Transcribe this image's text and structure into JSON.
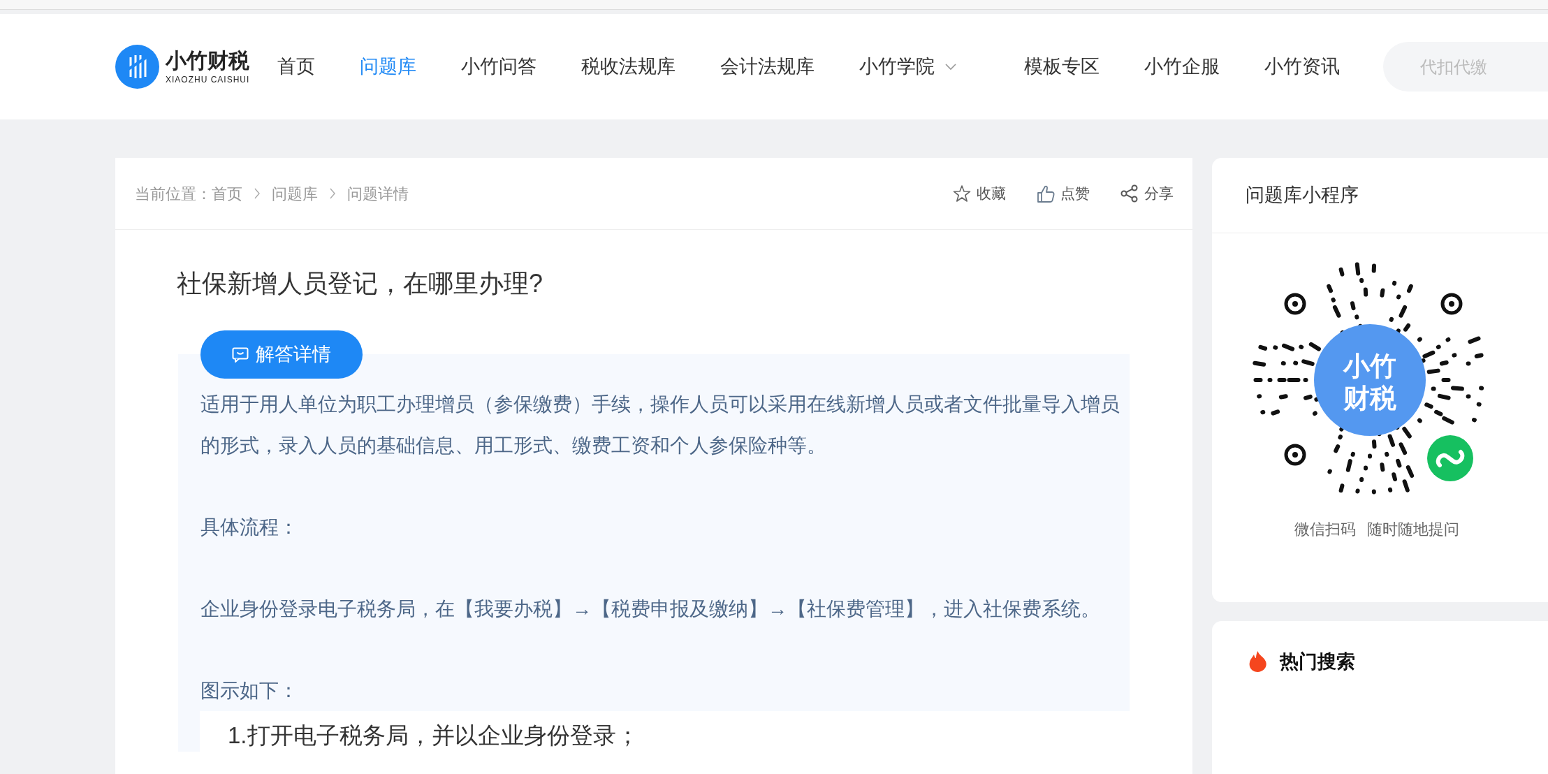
{
  "header": {
    "logo": {
      "name": "小竹财税",
      "subtitle": "XIAOZHU CAISHUI"
    },
    "nav": [
      {
        "label": "首页",
        "selected": false,
        "dropdown": false
      },
      {
        "label": "问题库",
        "selected": true,
        "dropdown": false
      },
      {
        "label": "小竹问答",
        "selected": false,
        "dropdown": false
      },
      {
        "label": "税收法规库",
        "selected": false,
        "dropdown": false
      },
      {
        "label": "会计法规库",
        "selected": false,
        "dropdown": false
      },
      {
        "label": "小竹学院",
        "selected": false,
        "dropdown": true
      },
      {
        "label": "模板专区",
        "selected": false,
        "dropdown": false
      },
      {
        "label": "小竹企服",
        "selected": false,
        "dropdown": false
      },
      {
        "label": "小竹资讯",
        "selected": false,
        "dropdown": false
      }
    ],
    "search": {
      "placeholder": "代扣代缴"
    }
  },
  "breadcrumb": {
    "label": "当前位置：",
    "items": [
      "首页",
      "问题库",
      "问题详情"
    ]
  },
  "actions": [
    {
      "kind": "favorite",
      "label": "收藏"
    },
    {
      "kind": "like",
      "label": "点赞"
    },
    {
      "kind": "share",
      "label": "分享"
    }
  ],
  "question": {
    "title": "社保新增人员登记，在哪里办理?"
  },
  "answer": {
    "button": "解答详情",
    "paragraphs": [
      {
        "kind": "text",
        "text": "适用于用人单位为职工办理增员（参保缴费）手续，操作人员可以采用在线新增人员或者文件批量导入增员的形式，录入人员的基础信息、用工形式、缴费工资和个人参保险种等。"
      },
      {
        "kind": "text",
        "text": "具体流程："
      },
      {
        "kind": "text",
        "text": "企业身份登录电子税务局，在【我要办税】→【税费申报及缴纳】→【社保费管理】，进入社保费系统。"
      },
      {
        "kind": "text",
        "text": "图示如下："
      },
      {
        "kind": "step",
        "text": "1.打开电子税务局，并以企业身份登录；"
      }
    ]
  },
  "sidebar": {
    "mini_program": {
      "title": "问题库小程序",
      "qr_text": [
        "小竹",
        "财税"
      ],
      "caption": [
        "微信扫码",
        "随时随地提问"
      ]
    },
    "hot_search": {
      "title": "热门搜索"
    }
  }
}
